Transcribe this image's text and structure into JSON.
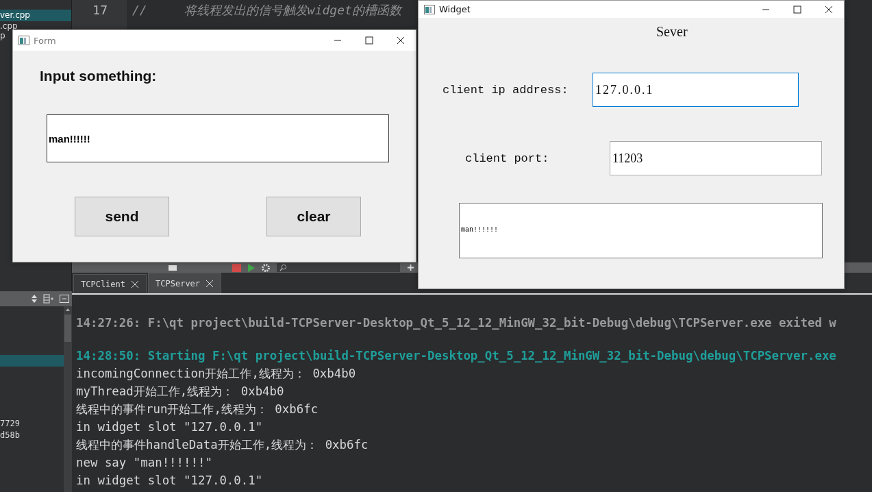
{
  "ide": {
    "files": [
      {
        "name": "ver.cpp",
        "selected": true
      },
      {
        "name": ".cpp",
        "selected": false
      },
      {
        "name": "p",
        "selected": false
      }
    ],
    "editor_lines": [
      {
        "number": "17",
        "code": "//     将线程发出的信号触发widget的槽函数",
        "current": false
      }
    ],
    "side_values": [
      "7729",
      "d58b"
    ],
    "output_tabs": [
      {
        "label": "TCPClient",
        "selected": false
      },
      {
        "label": "TCPServer",
        "selected": true
      }
    ],
    "output_lines": [
      {
        "kind": "info",
        "text": "14:27:26: F:\\qt project\\build-TCPServer-Desktop_Qt_5_12_12_MinGW_32_bit-Debug\\debug\\TCPServer.exe exited w"
      },
      {
        "kind": "start",
        "text": "14:28:50: Starting F:\\qt project\\build-TCPServer-Desktop_Qt_5_12_12_MinGW_32_bit-Debug\\debug\\TCPServer.exe"
      },
      {
        "kind": "plain",
        "text": "incomingConnection开始工作,线程为： 0xb4b0"
      },
      {
        "kind": "plain",
        "text": "myThread开始工作,线程为： 0xb4b0"
      },
      {
        "kind": "plain",
        "text": "线程中的事件run开始工作,线程为： 0xb6fc"
      },
      {
        "kind": "plain",
        "text": "in widget slot \"127.0.0.1\""
      },
      {
        "kind": "plain",
        "text": "线程中的事件handleData开始工作,线程为： 0xb6fc"
      },
      {
        "kind": "plain",
        "text": "new say \"man!!!!!!\""
      },
      {
        "kind": "plain",
        "text": "in widget slot \"127.0.0.1\""
      }
    ]
  },
  "form_window": {
    "title": "Form",
    "prompt": "Input something:",
    "input": {
      "value": "man!!!!!!"
    },
    "buttons": [
      "send",
      "clear"
    ]
  },
  "widget_window": {
    "title": "Widget",
    "heading": "Sever",
    "ip": {
      "label": "client ip address:",
      "value": "127.0.0.1",
      "focused": true
    },
    "port": {
      "label": "client port:",
      "value": "11203",
      "focused": false
    },
    "message_box": {
      "value": "man!!!!!!"
    }
  }
}
